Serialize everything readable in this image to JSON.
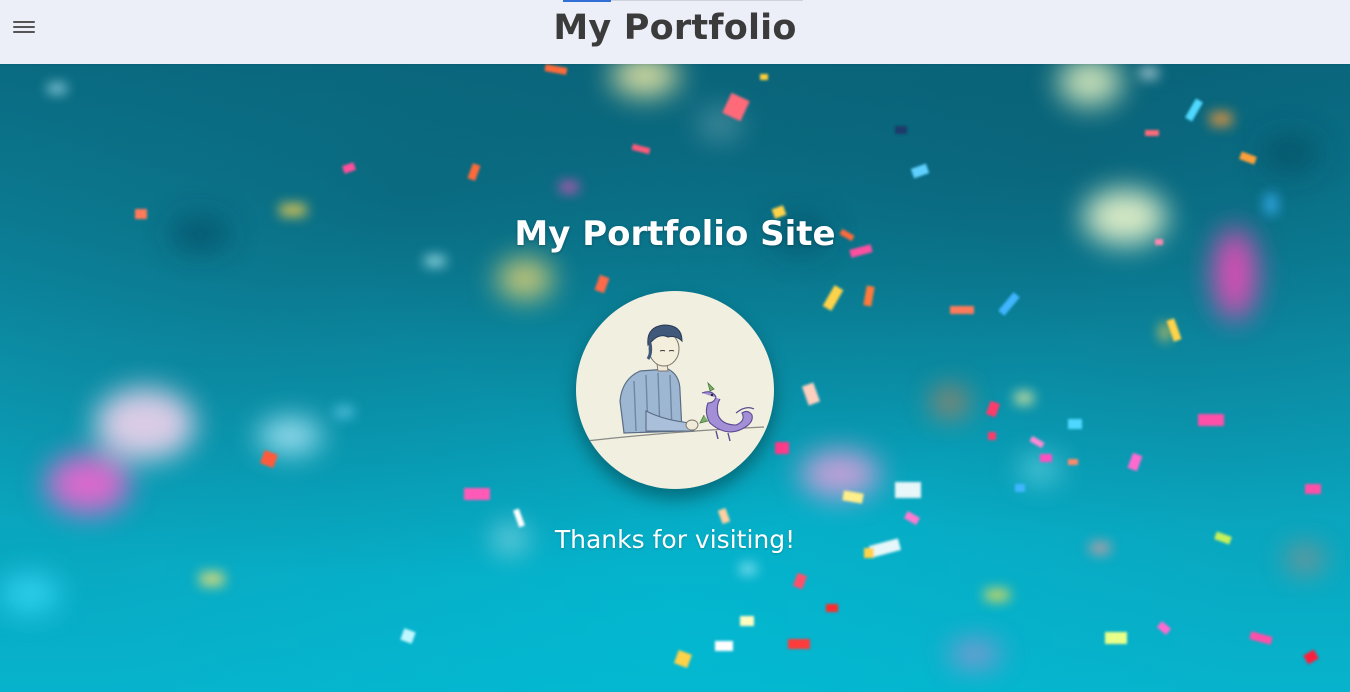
{
  "header": {
    "title": "My Portfolio",
    "menu_icon": "hamburger-menu-icon"
  },
  "hero": {
    "title": "My Portfolio Site",
    "subtitle": "Thanks for visiting!",
    "avatar_description_icon": "portrait-with-dragon-icon"
  },
  "colors": {
    "header_bg": "#eceef8",
    "hero_teal": "#0c97b0",
    "text_white": "#ffffff",
    "title_dark": "#3b3b3b"
  }
}
